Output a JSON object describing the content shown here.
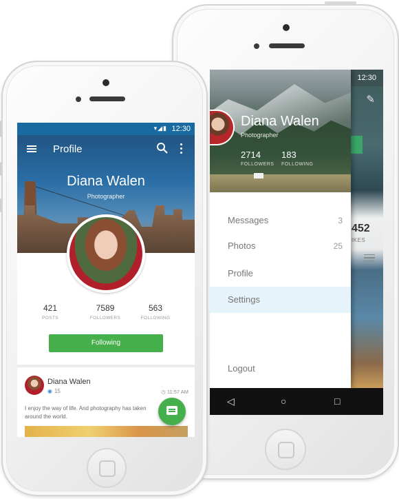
{
  "back_phone": {
    "status_time": "12:30",
    "drawer": {
      "name": "Diana Walen",
      "title": "Photographer",
      "stats": [
        {
          "value": "2714",
          "label": "FOLLOWERS"
        },
        {
          "value": "183",
          "label": "FOLLOWING"
        }
      ],
      "items": [
        {
          "label": "Messages",
          "count": "3"
        },
        {
          "label": "Photos",
          "count": "25"
        },
        {
          "label": "Profile",
          "count": ""
        },
        {
          "label": "Settings",
          "count": ""
        },
        {
          "label": "Logout",
          "count": ""
        }
      ],
      "active_item": "Settings"
    },
    "background": {
      "likes_value": "452",
      "likes_label": "IKES"
    },
    "nav": {
      "back": "◁",
      "home": "○",
      "recent": "□"
    }
  },
  "front_phone": {
    "status_time": "12:30",
    "app_title": "Profile",
    "hero": {
      "name": "Diana Walen",
      "title": "Photographer"
    },
    "stats": [
      {
        "value": "421",
        "label": "POSTS"
      },
      {
        "value": "7589",
        "label": "FOLLOWERS"
      },
      {
        "value": "563",
        "label": "FOLLOWING"
      }
    ],
    "follow_button": "Following",
    "post": {
      "author": "Diana Walen",
      "views": "15",
      "time": "11:57 AM",
      "text": "I enjoy the way of life. And photography has taken around the world."
    }
  },
  "colors": {
    "accent_green": "#45b04b",
    "toolbar_blue": "#1a6aa2",
    "active_row": "#e7f3fb"
  }
}
